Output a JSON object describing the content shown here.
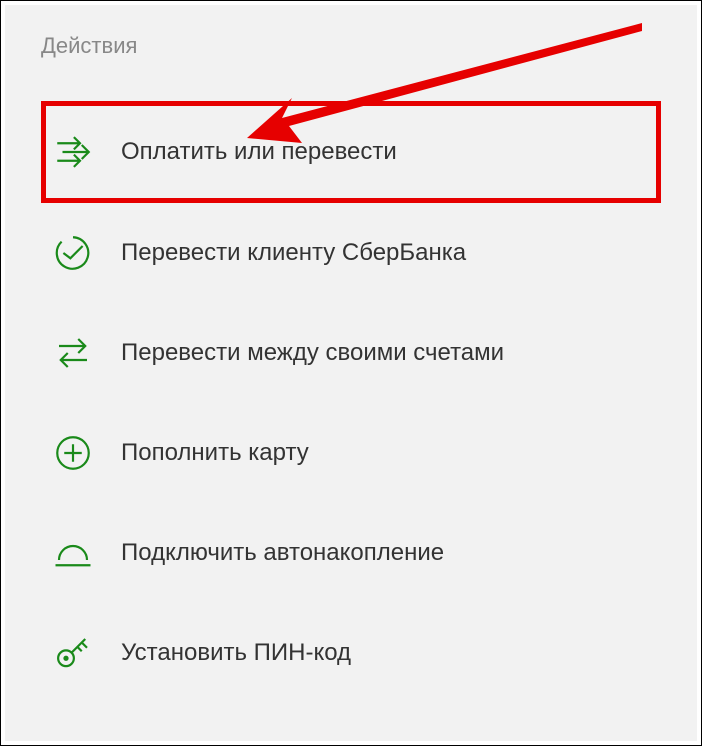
{
  "section_title": "Действия",
  "menu_items": [
    {
      "label": "Оплатить или перевести",
      "icon_name": "pay-transfer-icon",
      "highlighted": true
    },
    {
      "label": "Перевести клиенту СберБанка",
      "icon_name": "transfer-client-icon",
      "highlighted": false
    },
    {
      "label": "Перевести между своими счетами",
      "icon_name": "transfer-between-icon",
      "highlighted": false
    },
    {
      "label": "Пополнить карту",
      "icon_name": "topup-card-icon",
      "highlighted": false
    },
    {
      "label": "Подключить автонакопление",
      "icon_name": "auto-savings-icon",
      "highlighted": false
    },
    {
      "label": "Установить ПИН-код",
      "icon_name": "set-pin-icon",
      "highlighted": false
    }
  ],
  "colors": {
    "accent_green": "#1a8a1a",
    "highlight_red": "#e60000"
  }
}
